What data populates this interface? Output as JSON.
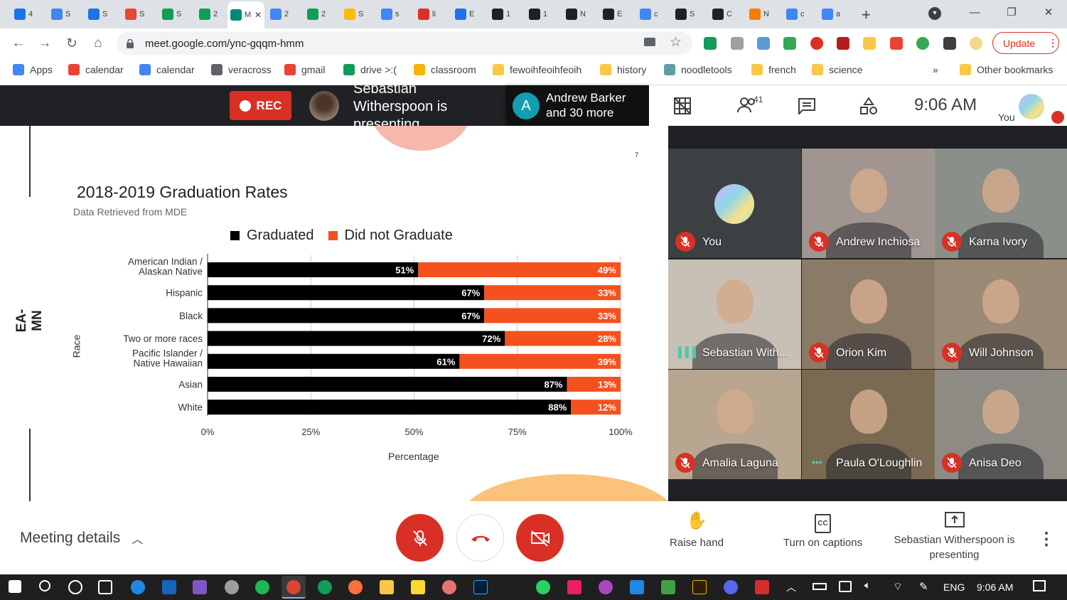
{
  "browser": {
    "tabs": [
      {
        "title": "4",
        "color": "#1a73e8"
      },
      {
        "title": "S",
        "color": "#4285f4"
      },
      {
        "title": "S",
        "color": "#1a73e8"
      },
      {
        "title": "S",
        "color": "#ea4335"
      },
      {
        "title": "S",
        "color": "#0f9d58"
      },
      {
        "title": "2",
        "color": "#0f9d58"
      },
      {
        "title": "M",
        "color": "#00897b"
      },
      {
        "title": "2",
        "color": "#4285f4"
      },
      {
        "title": "2",
        "color": "#0f9d58"
      },
      {
        "title": "S",
        "color": "#fbbc04"
      },
      {
        "title": "s",
        "color": "#4285f4"
      },
      {
        "title": "li",
        "color": "#d93025"
      },
      {
        "title": "E",
        "color": "#1a73e8"
      },
      {
        "title": "1",
        "color": "#202124"
      },
      {
        "title": "1",
        "color": "#202124"
      },
      {
        "title": "N",
        "color": "#202124"
      },
      {
        "title": "E",
        "color": "#202124"
      },
      {
        "title": "c",
        "color": "#4285f4"
      },
      {
        "title": "S",
        "color": "#202124"
      },
      {
        "title": "C",
        "color": "#202124"
      },
      {
        "title": "N",
        "color": "#f57c00"
      },
      {
        "title": "c",
        "color": "#4285f4"
      },
      {
        "title": "a",
        "color": "#4285f4"
      }
    ],
    "url": "meet.google.com/ync-gqqm-hmm",
    "update_label": "Update",
    "bookmarks": [
      {
        "label": "Apps",
        "color": "#4285f4",
        "folder": false
      },
      {
        "label": "calendar",
        "color": "#ea4335",
        "folder": false
      },
      {
        "label": "calendar",
        "color": "#4285f4",
        "folder": false
      },
      {
        "label": "veracross",
        "color": "#5f6368",
        "folder": false
      },
      {
        "label": "gmail",
        "color": "#ea4335",
        "folder": false
      },
      {
        "label": "drive >:(",
        "color": "#0f9d58",
        "folder": false
      },
      {
        "label": "classroom",
        "color": "#f4b400",
        "folder": false
      },
      {
        "label": "fewoihfeoihfeoih",
        "color": "#f9c846",
        "folder": true
      },
      {
        "label": "history",
        "color": "#f9c846",
        "folder": true
      },
      {
        "label": "noodletools",
        "color": "#5f9ea0",
        "folder": false
      },
      {
        "label": "french",
        "color": "#f9c846",
        "folder": true
      },
      {
        "label": "science",
        "color": "#f9c846",
        "folder": true
      }
    ],
    "more_bookmarks": "»",
    "other_bookmarks": "Other bookmarks"
  },
  "meet_header": {
    "rec_label": "REC",
    "presenting_text": "Sebastian Witherspoon is presenting",
    "ab_initial": "A",
    "ab_text": "Andrew Barker and 30 more",
    "participants_count": "41",
    "clock": "9:06 AM",
    "you_label": "You"
  },
  "slide": {
    "side_label": "EA-MN",
    "page_mark": "7"
  },
  "chart_data": {
    "type": "bar",
    "orientation": "horizontal",
    "stacked": true,
    "title": "2018-2019 Graduation Rates",
    "subtitle": "Data Retrieved from MDE",
    "xlabel": "Percentage",
    "ylabel": "Race",
    "xlim": [
      0,
      100
    ],
    "xticks": [
      "0%",
      "25%",
      "50%",
      "75%",
      "100%"
    ],
    "legend_position": "top",
    "categories": [
      "American Indian / Alaskan Native",
      "Hispanic",
      "Black",
      "Two or more races",
      "Pacific Islander / Native Hawaiian",
      "Asian",
      "White"
    ],
    "series": [
      {
        "name": "Graduated",
        "color": "#000000",
        "values": [
          51,
          67,
          67,
          72,
          61,
          87,
          88
        ],
        "labels": [
          "51%",
          "67%",
          "67%",
          "72%",
          "61%",
          "87%",
          "88%"
        ]
      },
      {
        "name": "Did not Graduate",
        "color": "#f4511e",
        "values": [
          49,
          33,
          33,
          28,
          39,
          13,
          12
        ],
        "labels": [
          "49%",
          "33%",
          "33%",
          "28%",
          "39%",
          "13%",
          "12%"
        ]
      }
    ]
  },
  "participants": [
    {
      "name": "You",
      "status": "muted",
      "bg": "#3c4043",
      "avatar": true
    },
    {
      "name": "Andrew Inchiosa",
      "status": "muted",
      "bg": "#a09590"
    },
    {
      "name": "Karna Ivory",
      "status": "muted",
      "bg": "#8a8f8a"
    },
    {
      "name": "Sebastian With...",
      "status": "speaking",
      "bg": "#c8c0b4"
    },
    {
      "name": "Orion Kim",
      "status": "muted",
      "bg": "#8a7a68"
    },
    {
      "name": "Will Johnson",
      "status": "muted",
      "bg": "#9a8a76"
    },
    {
      "name": "Amalia Laguna",
      "status": "muted",
      "bg": "#b9a690"
    },
    {
      "name": "Paula O'Loughlin",
      "status": "speaking",
      "bg": "#7a6a52"
    },
    {
      "name": "Anisa Deo",
      "status": "muted",
      "bg": "#8e8a84"
    }
  ],
  "bottom": {
    "meeting_details": "Meeting details",
    "raise_hand": "Raise hand",
    "captions": "Turn on captions",
    "presenting": "Sebastian Witherspoon is presenting"
  },
  "taskbar": {
    "lang": "ENG",
    "time": "9:06 AM"
  }
}
